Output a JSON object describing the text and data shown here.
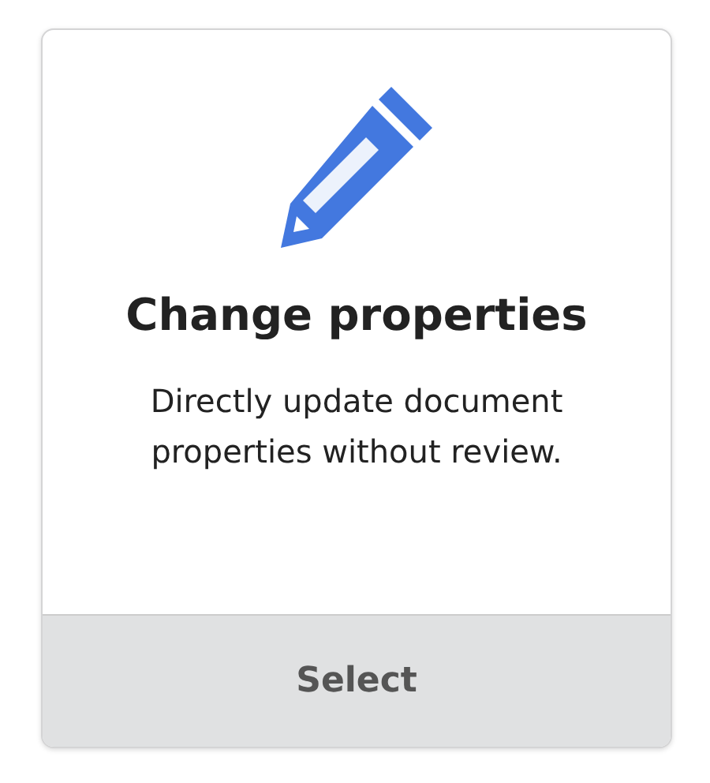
{
  "card": {
    "title": "Change properties",
    "description": "Directly update document properties without review.",
    "button": "Select"
  }
}
